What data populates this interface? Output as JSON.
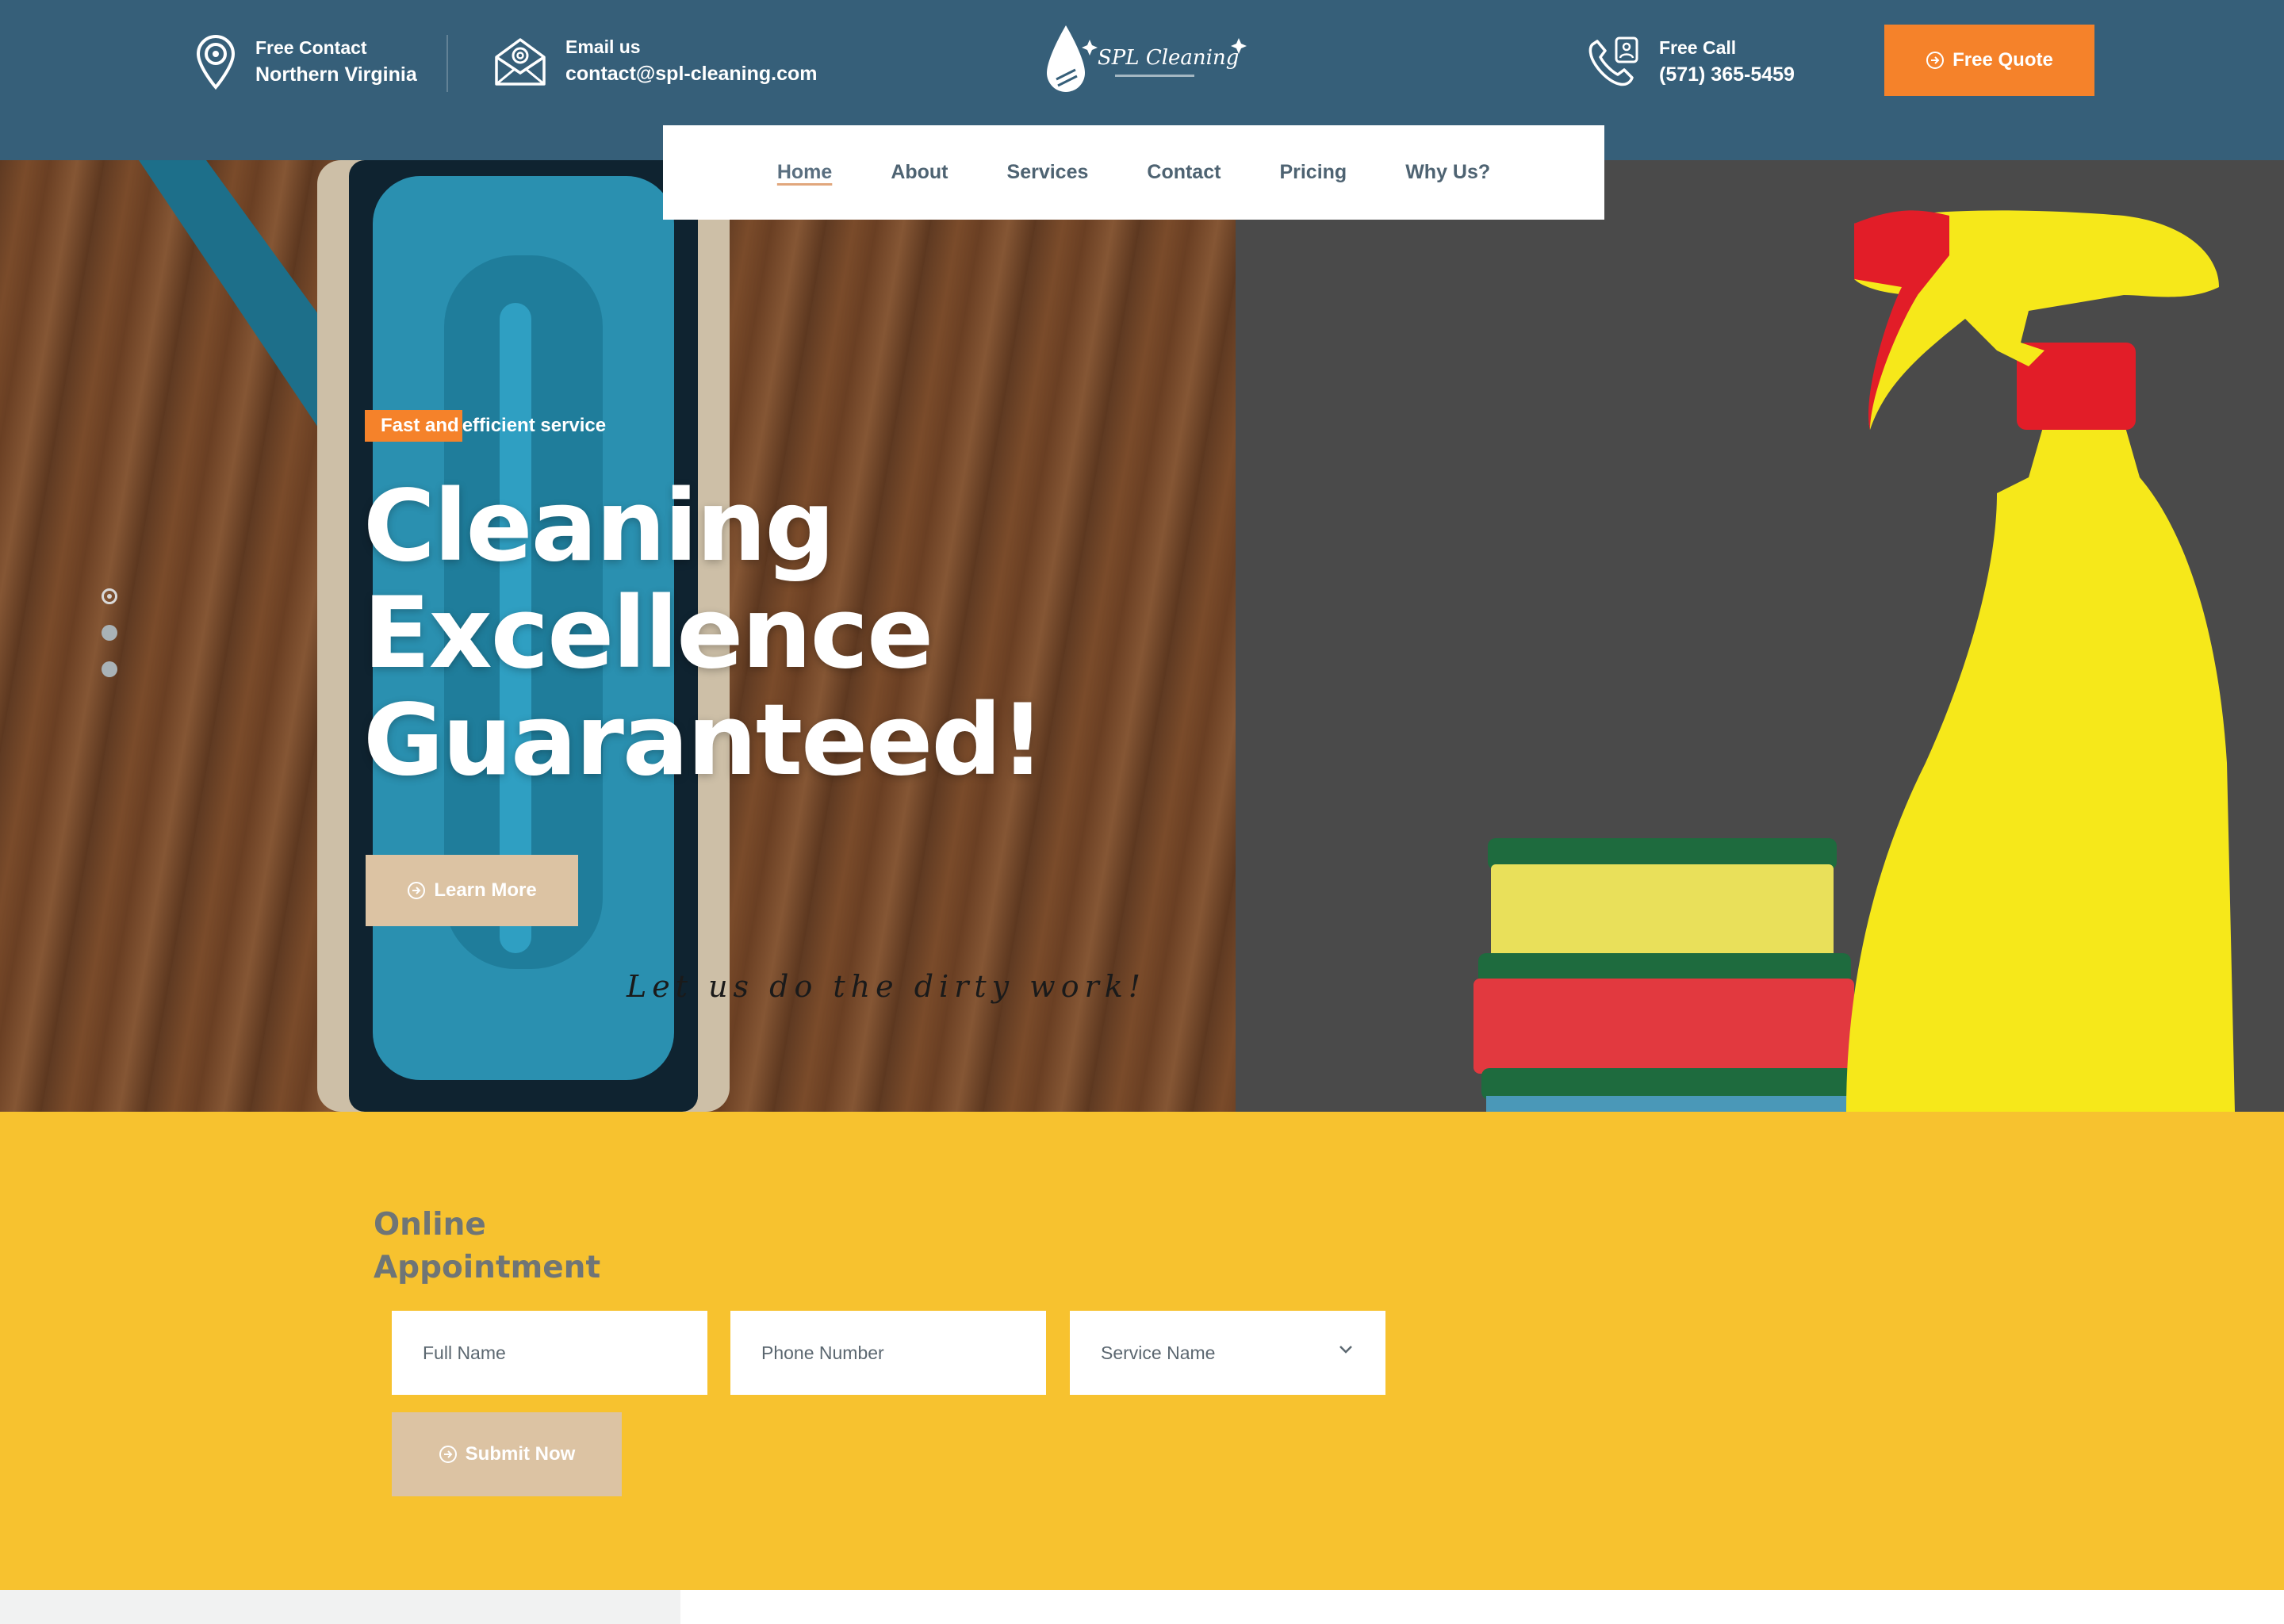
{
  "header": {
    "location": {
      "title": "Free Contact",
      "value": "Northern Virginia",
      "icon": "location-pin-icon"
    },
    "email": {
      "title": "Email us",
      "value": "contact@spl-cleaning.com",
      "icon": "envelope-icon"
    },
    "logo": {
      "brand": "SPL Cleaning",
      "icon": "water-drop-icon"
    },
    "phone": {
      "title": "Free Call",
      "value": "(571) 365-5459",
      "icon": "phone-icon"
    },
    "quote_button": "Free Quote"
  },
  "nav": {
    "items": [
      {
        "label": "Home",
        "active": true
      },
      {
        "label": "About"
      },
      {
        "label": "Services"
      },
      {
        "label": "Contact"
      },
      {
        "label": "Pricing"
      },
      {
        "label": "Why Us?"
      }
    ]
  },
  "hero": {
    "badge_highlight": "Fast and",
    "badge_rest": " efficient service",
    "title_lines": [
      "Cleaning",
      "Excellence",
      "Guaranteed!"
    ],
    "button": "Learn More",
    "tagline": "Let us do the dirty work!",
    "slides": {
      "count": 3,
      "active": 1
    }
  },
  "appointment": {
    "title_lines": [
      "Online",
      "Appointment"
    ],
    "fields": {
      "full_name": "Full Name",
      "phone": "Phone Number",
      "service": "Service Name"
    },
    "submit": "Submit Now"
  },
  "colors": {
    "topbar": "#365f79",
    "accent_orange": "#f5822a",
    "appointment_bg": "#f7c22f",
    "beige_button": "#dcc3a3"
  }
}
